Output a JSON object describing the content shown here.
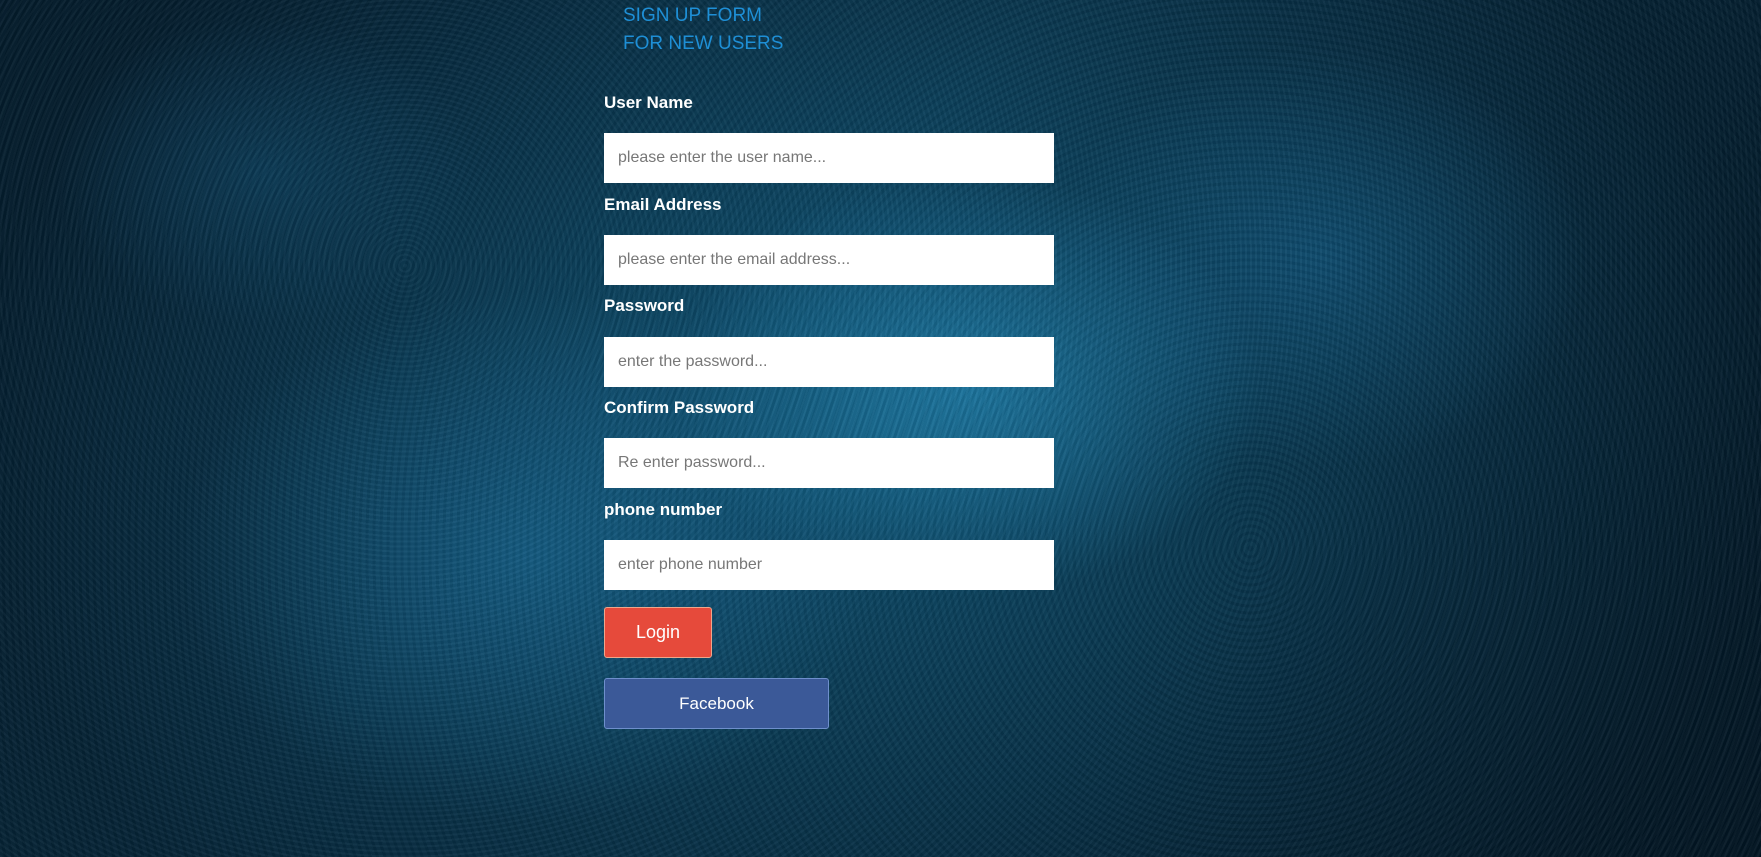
{
  "header": {
    "title_line1": "SIGN UP FORM",
    "title_line2": "FOR NEW USERS"
  },
  "form": {
    "username": {
      "label": "User Name",
      "placeholder": "please enter the user name..."
    },
    "email": {
      "label": "Email Address",
      "placeholder": "please enter the email address..."
    },
    "password": {
      "label": "Password",
      "placeholder": "enter the password..."
    },
    "confirm_password": {
      "label": "Confirm Password",
      "placeholder": "Re enter password..."
    },
    "phone": {
      "label": "phone number",
      "placeholder": "enter phone number"
    },
    "login_label": "Login",
    "facebook_label": "Facebook"
  },
  "colors": {
    "title": "#1e8fd6",
    "login_button": "#e64a3b",
    "facebook_button": "#3b5998",
    "background": "#0b3a52"
  }
}
